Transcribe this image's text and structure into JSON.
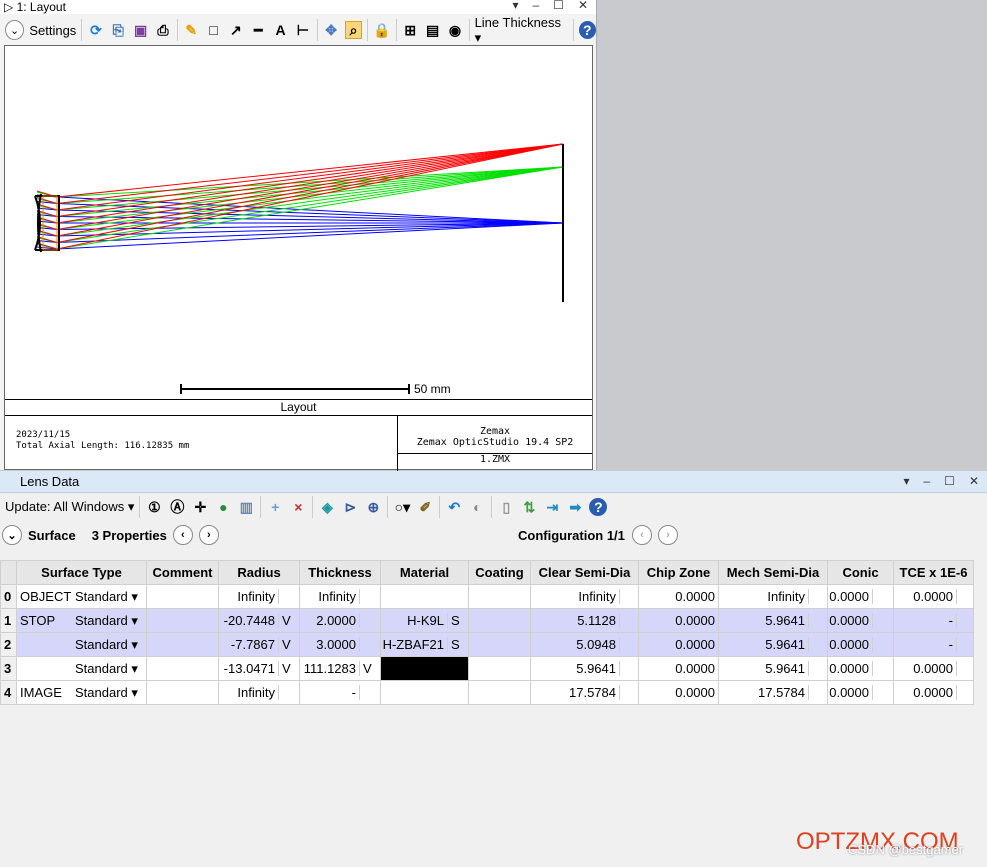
{
  "layout_window": {
    "title": "1: Layout",
    "toolbar": {
      "settings": "Settings",
      "line_thickness": "Line Thickness"
    },
    "scale_label": "50 mm",
    "plot_title": "Layout",
    "date": "2023/11/15",
    "axial_length": "Total Axial Length:  116.12835 mm",
    "company": "Zemax",
    "product": "Zemax OpticStudio 19.4 SP2",
    "file": "1.ZMX"
  },
  "ray_colors": {
    "field1": "#0000ff",
    "field2": "#00e000",
    "field3": "#ff0000"
  },
  "lens_data": {
    "title": "Lens Data",
    "update": "Update: All Windows",
    "surface": "Surface",
    "properties": "3 Properties",
    "configuration": "Configuration 1/1",
    "columns": [
      "Surface Type",
      "Comment",
      "Radius",
      "Thickness",
      "Material",
      "Coating",
      "Clear Semi-Dia",
      "Chip Zone",
      "Mech Semi-Dia",
      "Conic",
      "TCE x 1E-6"
    ],
    "rows": [
      {
        "n": "0",
        "name": "OBJECT",
        "type": "Standard",
        "comment": "",
        "radius": "Infinity",
        "rs": "",
        "thick": "Infinity",
        "ts": "",
        "mat": "",
        "ms": "",
        "clear": "Infinity",
        "chip": "0.0000",
        "mech": "Infinity",
        "conic": "0.0000",
        "tce": "0.0000"
      },
      {
        "n": "1",
        "name": "STOP",
        "type": "Standard",
        "comment": "",
        "radius": "-20.7448",
        "rs": "V",
        "thick": "2.0000",
        "ts": "",
        "mat": "H-K9L",
        "ms": "S",
        "clear": "5.1128",
        "chip": "0.0000",
        "mech": "5.9641",
        "conic": "0.0000",
        "tce": "-"
      },
      {
        "n": "2",
        "name": "",
        "type": "Standard",
        "comment": "",
        "radius": "-7.7867",
        "rs": "V",
        "thick": "3.0000",
        "ts": "",
        "mat": "H-ZBAF21",
        "ms": "S",
        "clear": "5.0948",
        "chip": "0.0000",
        "mech": "5.9641",
        "conic": "0.0000",
        "tce": "-"
      },
      {
        "n": "3",
        "name": "",
        "type": "Standard",
        "comment": "",
        "radius": "-13.0471",
        "rs": "V",
        "thick": "111.1283",
        "ts": "V",
        "mat": "",
        "ms": "",
        "clear": "5.9641",
        "chip": "0.0000",
        "mech": "5.9641",
        "conic": "0.0000",
        "tce": "0.0000"
      },
      {
        "n": "4",
        "name": "IMAGE",
        "type": "Standard",
        "comment": "",
        "radius": "Infinity",
        "rs": "",
        "thick": "-",
        "ts": "",
        "mat": "",
        "ms": "",
        "clear": "17.5784",
        "chip": "0.0000",
        "mech": "17.5784",
        "conic": "0.0000",
        "tce": "0.0000"
      }
    ]
  },
  "watermark": {
    "site": "OPTZMX.COM",
    "credit": "CSDN @bestgamer"
  }
}
